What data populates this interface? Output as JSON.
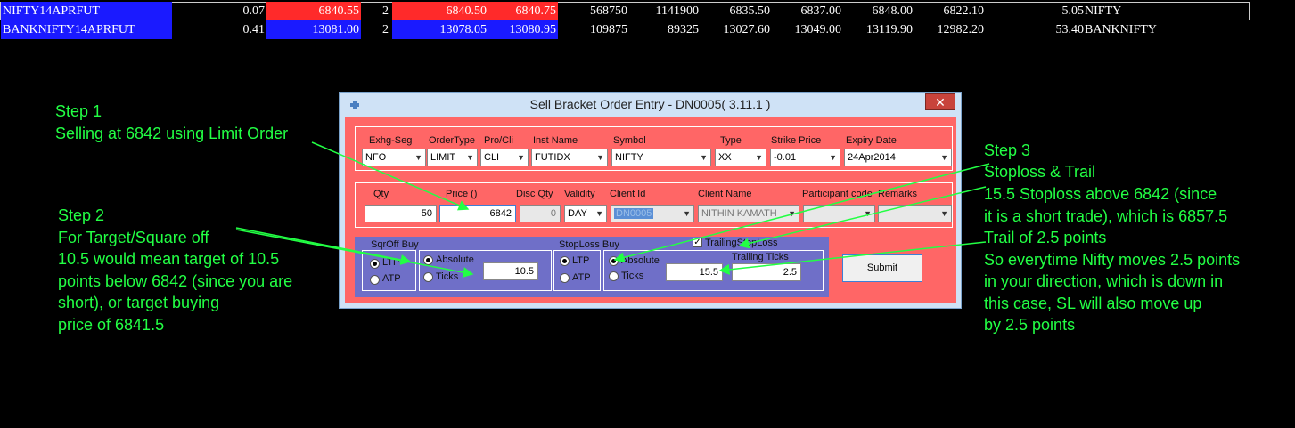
{
  "market_rows": [
    {
      "symbol": "NIFTY14APRFUT",
      "change": "0.07",
      "bid": "6840.55",
      "qty": "2",
      "ask": "6840.50",
      "ask2": "6840.75",
      "vol1": "568750",
      "vol2": "1141900",
      "open": "6835.50",
      "high": "6837.00",
      "close": "6848.00",
      "low": "6822.10",
      "last": "5.05",
      "name": "NIFTY"
    },
    {
      "symbol": "BANKNIFTY14APRFUT",
      "change": "0.41",
      "bid": "13081.00",
      "qty": "2",
      "ask": "13078.05",
      "ask2": "13080.95",
      "vol1": "109875",
      "vol2": "89325",
      "open": "13027.60",
      "high": "13049.00",
      "close": "13119.90",
      "low": "12982.20",
      "last": "53.40",
      "name": "BANKNIFTY"
    }
  ],
  "dialog": {
    "title": "Sell Bracket Order Entry - DN0005( 3.11.1 )",
    "close": "✕",
    "row1": {
      "labels": [
        "Exhg-Seg",
        "OrderType",
        "Pro/Cli",
        "Inst Name",
        "Symbol",
        "Type",
        "Strike Price",
        "Expiry Date"
      ],
      "exchange": "NFO",
      "order_type": "LIMIT",
      "pro_cli": "CLI",
      "inst_name": "FUTIDX",
      "symbol": "NIFTY",
      "type": "XX",
      "strike_price": "-0.01",
      "expiry": "24Apr2014"
    },
    "row2": {
      "labels": [
        "Qty",
        "Price ()",
        "Disc Qty",
        "Validity",
        "Client Id",
        "Client Name",
        "Participant code",
        "Remarks"
      ],
      "qty": "50",
      "price": "6842",
      "disc_qty": "0",
      "validity": "DAY",
      "client_id": "DN0005",
      "client_name": "NITHIN KAMATH",
      "participant_code": "",
      "remarks": ""
    },
    "sqroff": {
      "title": "SqrOff Buy",
      "ltp": "LTP",
      "atp": "ATP",
      "absolute": "Absolute",
      "ticks": "Ticks",
      "value": "10.5"
    },
    "stoploss": {
      "title": "StopLoss Buy",
      "ltp": "LTP",
      "atp": "ATP",
      "absolute": "Absolute",
      "ticks": "Ticks",
      "value": "15.5",
      "trailing_label": "TrailingStopLoss",
      "trailing_ticks_label": "Trailing Ticks",
      "trailing_value": "2.5"
    },
    "submit": "Submit"
  },
  "annotations": {
    "step1": [
      "Step 1",
      "Selling at 6842 using Limit Order"
    ],
    "step2": [
      "Step 2",
      "For Target/Square off",
      "10.5 would mean target of 10.5",
      "points below 6842 (since you are",
      "short), or target buying",
      "price of 6841.5"
    ],
    "step3": [
      "Step 3",
      "Stoploss & Trail",
      "15.5 Stoploss above 6842 (since",
      "it is a short trade), which is 6857.5",
      "Trail of 2.5 points",
      "So everytime Nifty moves 2.5 points",
      "in your direction, which is down in",
      "this case, SL will also move up",
      "by 2.5 points"
    ]
  },
  "colors": {
    "annotation": "#22ff44",
    "dialog_body": "#ff6666",
    "stop_panel": "#6f6fc8",
    "bid_cell": "#ff2a2a",
    "symbol_cell": "#1a1aff"
  }
}
